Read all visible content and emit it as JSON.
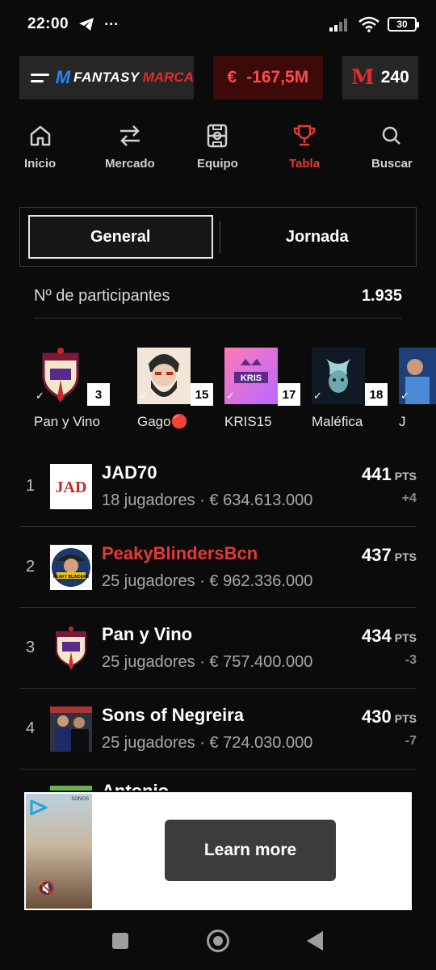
{
  "status_bar": {
    "time": "22:00",
    "battery": "30"
  },
  "header": {
    "brand_fantasy": "FANTASY",
    "brand_marca": "MARCA",
    "balance_symbol": "€",
    "balance": "-167,5M",
    "points_logo": "M",
    "points": "240"
  },
  "nav": {
    "items": [
      {
        "label": "Inicio",
        "icon": "home-icon"
      },
      {
        "label": "Mercado",
        "icon": "transfer-arrows-icon"
      },
      {
        "label": "Equipo",
        "icon": "pitch-icon"
      },
      {
        "label": "Tabla",
        "icon": "trophy-icon"
      },
      {
        "label": "Buscar",
        "icon": "search-icon"
      }
    ],
    "active": "Tabla"
  },
  "tabs": {
    "general": "General",
    "jornada": "Jornada",
    "active": "General"
  },
  "participants": {
    "label": "Nº de participantes",
    "count": "1.935"
  },
  "favorites": [
    {
      "name": "Pan y Vino",
      "badge": "3"
    },
    {
      "name": "Gago🔴",
      "badge": "15"
    },
    {
      "name": "KRIS15",
      "badge": "17"
    },
    {
      "name": "Maléfica",
      "badge": "18"
    },
    {
      "name": "J",
      "badge": ""
    }
  ],
  "ranking": [
    {
      "position": "1",
      "team": "JAD70",
      "meta": "18 jugadores · € 634.613.000",
      "points": "441",
      "pts_label": "PTS",
      "delta": "+4",
      "highlight": false
    },
    {
      "position": "2",
      "team": "PeakyBlindersBcn",
      "meta": "25 jugadores · € 962.336.000",
      "points": "437",
      "pts_label": "PTS",
      "delta": "",
      "highlight": true
    },
    {
      "position": "3",
      "team": "Pan y Vino",
      "meta": "25 jugadores · € 757.400.000",
      "points": "434",
      "pts_label": "PTS",
      "delta": "-3",
      "highlight": false
    },
    {
      "position": "4",
      "team": "Sons of Negreira",
      "meta": "25 jugadores · € 724.030.000",
      "points": "430",
      "pts_label": "PTS",
      "delta": "-7",
      "highlight": false
    }
  ],
  "partial_row": {
    "team": "Antonio"
  },
  "ad": {
    "cta": "Learn more",
    "brand": "SONOS"
  },
  "colors": {
    "accent_red": "#e53935",
    "balance_bg": "#3d0a0a",
    "brand_blue": "#1e88ff"
  }
}
